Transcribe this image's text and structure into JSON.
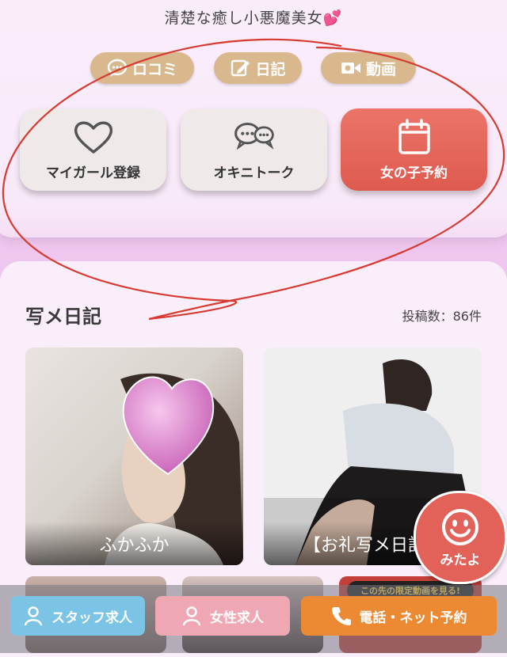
{
  "header": {
    "tagline": "清楚な癒し小悪魔美女💕"
  },
  "pills": [
    {
      "label": "ロコミ",
      "icon": "chat-bubble-icon"
    },
    {
      "label": "日記",
      "icon": "edit-icon"
    },
    {
      "label": "動画",
      "icon": "video-camera-icon"
    }
  ],
  "actions": [
    {
      "label": "マイガール登録",
      "icon": "heart-icon"
    },
    {
      "label": "オキニトーク",
      "icon": "chat-bubbles-icon"
    },
    {
      "label": "女の子予約",
      "icon": "calendar-icon"
    }
  ],
  "diary": {
    "title": "写メ日記",
    "count": "投稿数：86件",
    "posts": [
      {
        "caption": "ふかふか"
      },
      {
        "caption": "【お礼写メ日記"
      }
    ],
    "partial_thumb_text": "この先の限定動画を見る!"
  },
  "float_button": {
    "label": "みたよ",
    "icon": "smiley-icon"
  },
  "bottom_bar": {
    "staff": "スタッフ求人",
    "female": "女性求人",
    "phone": "電話・ネット予約"
  },
  "colors": {
    "accent_red": "#e0604f",
    "pill_tan": "#d9b88d",
    "staff_blue": "#7cc4e6",
    "female_pink": "#f0a7b4",
    "phone_orange": "#ec8a33"
  }
}
